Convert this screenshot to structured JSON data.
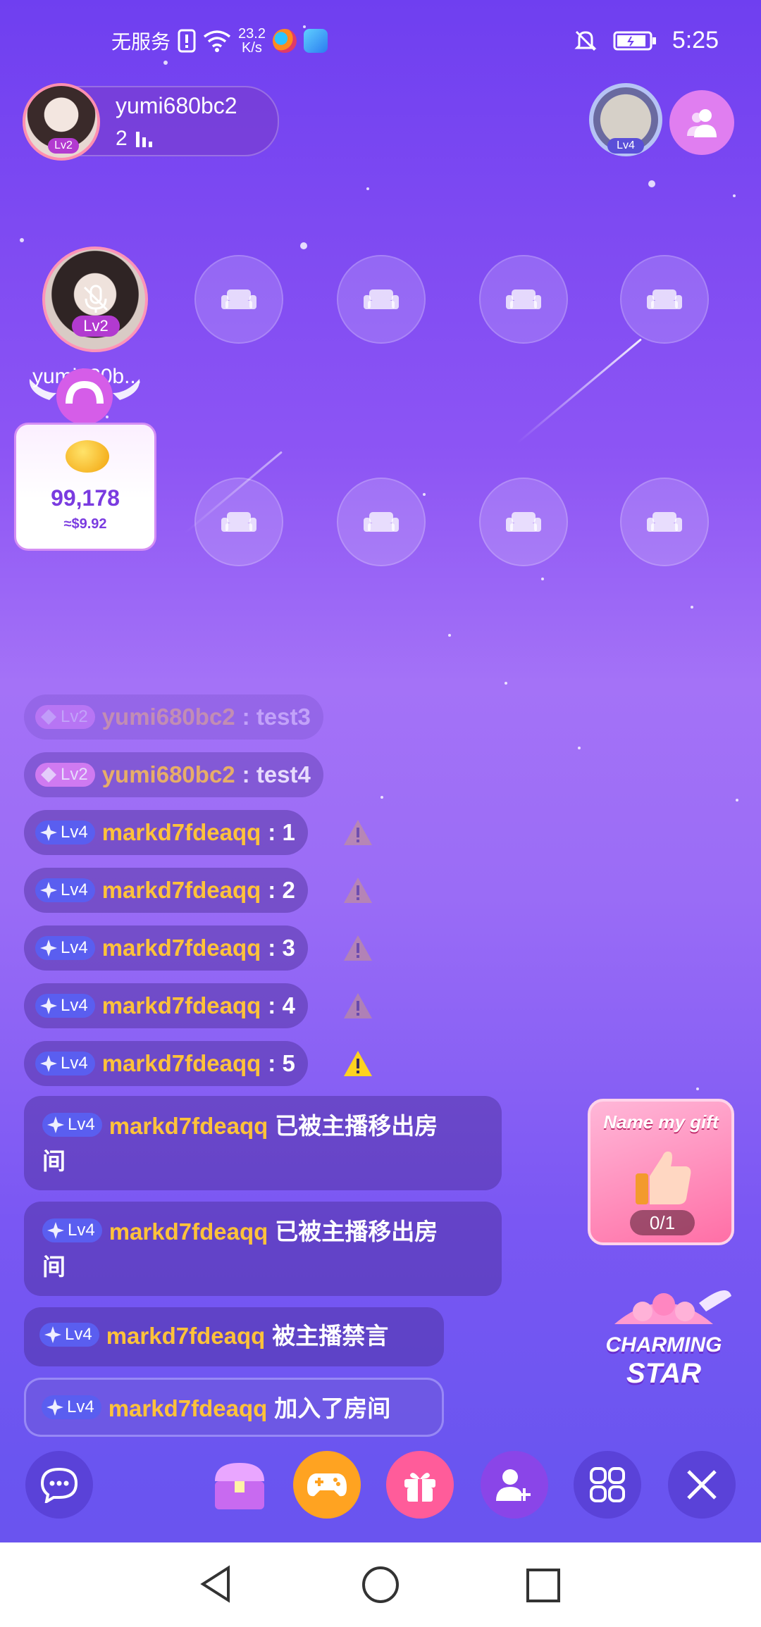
{
  "status_bar": {
    "carrier": "无服务",
    "net_speed_value": "23.2",
    "net_speed_unit": "K/s",
    "time": "5:25"
  },
  "host": {
    "name": "yumi680bc2",
    "level": "Lv2",
    "viewer_count": "2"
  },
  "top_right_user": {
    "level": "Lv4"
  },
  "host_seat": {
    "level": "Lv2",
    "name": "yumi680b..."
  },
  "bean": {
    "value": "99,178",
    "usd": "≈$9.92"
  },
  "chat": {
    "messages": [
      {
        "level": "Lv2",
        "user": "yumi680bc2",
        "text": ": test3"
      },
      {
        "level": "Lv2",
        "user": "yumi680bc2",
        "text": ": test4"
      },
      {
        "level": "Lv4",
        "user": "markd7fdeaqq",
        "text": ": 1"
      },
      {
        "level": "Lv4",
        "user": "markd7fdeaqq",
        "text": ": 2"
      },
      {
        "level": "Lv4",
        "user": "markd7fdeaqq",
        "text": ": 3"
      },
      {
        "level": "Lv4",
        "user": "markd7fdeaqq",
        "text": ": 4"
      },
      {
        "level": "Lv4",
        "user": "markd7fdeaqq",
        "text": ": 5"
      }
    ],
    "system": [
      {
        "level": "Lv4",
        "user": "markd7fdeaqq",
        "text": "已被主播移出房",
        "text2": "间"
      },
      {
        "level": "Lv4",
        "user": "markd7fdeaqq",
        "text": "已被主播移出房",
        "text2": "间"
      },
      {
        "level": "Lv4",
        "user": "markd7fdeaqq",
        "text": "被主播禁言"
      },
      {
        "level": "Lv4",
        "user": "markd7fdeaqq",
        "text": "加入了房间"
      }
    ]
  },
  "gift_task": {
    "title": "Name my gift",
    "progress": "0/1"
  },
  "charming_star": {
    "line1": "CHARMING",
    "line2": "STAR"
  },
  "colors": {
    "username": "#ffc23a",
    "lv4_chip": "#5a5ef0",
    "lv2_chip": "#e07ef0",
    "game_button": "#ffa321",
    "gift_button": "#ff5c9a",
    "invite_button": "#8a45e8"
  }
}
